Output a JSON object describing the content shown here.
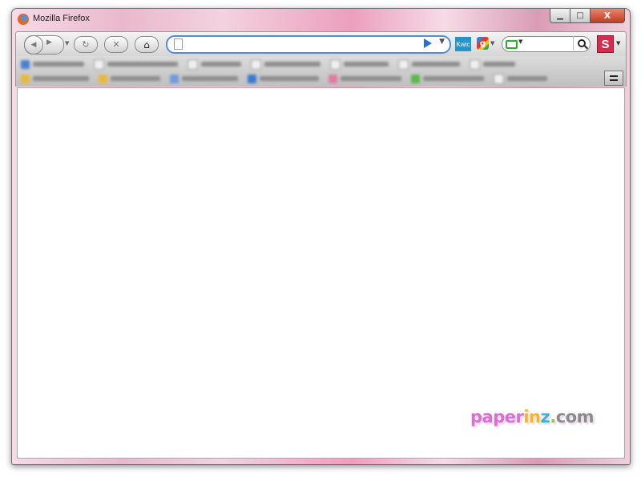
{
  "window": {
    "title": "Mozilla Firefox",
    "controls": {
      "minimize": "▁",
      "maximize": "□",
      "close": "X"
    }
  },
  "navbar": {
    "back_glyph": "◀",
    "forward_glyph": "▶",
    "reload_glyph": "↻",
    "stop_glyph": "✕",
    "home_glyph": "⌂",
    "url": {
      "value": "",
      "placeholder": ""
    },
    "addons": {
      "kwic_label": "Kwic",
      "google_letter": "g"
    },
    "search": {
      "value": "",
      "placeholder": ""
    },
    "s_label": "S",
    "accent_color": "#4d8fd6"
  },
  "watermark": {
    "part1": "paper",
    "part2": "in",
    "part3": "z",
    "part4": ".",
    "part5": "com"
  }
}
